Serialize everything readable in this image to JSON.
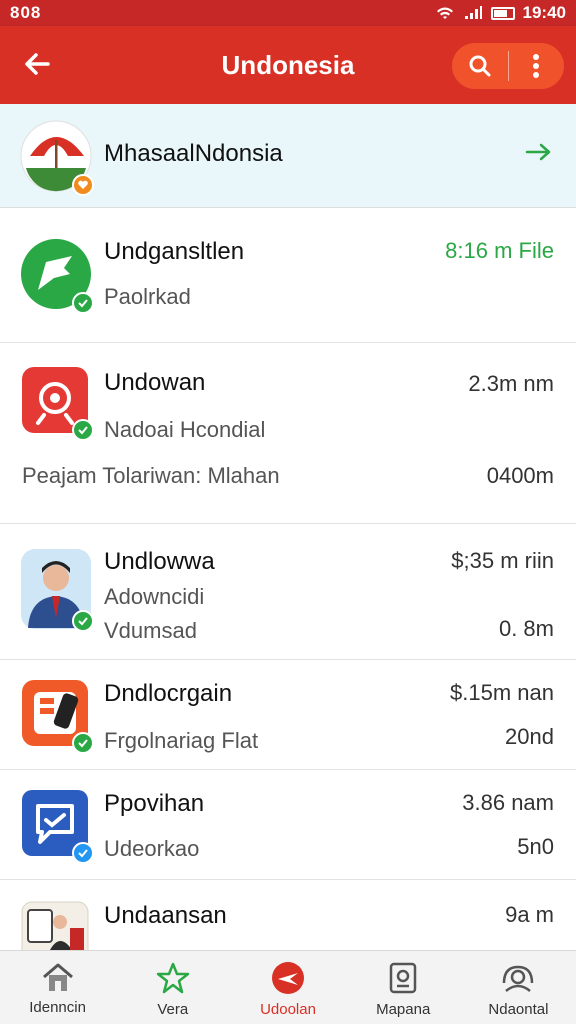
{
  "status_bar": {
    "left": "808",
    "time": "19:40"
  },
  "app_bar": {
    "title": "Undonesia"
  },
  "featured": {
    "title": "MhasaalNdonsia"
  },
  "items": [
    {
      "name": "Undgansltlen",
      "right_top": "8:16 m File",
      "subtitle": "Paolrkad"
    },
    {
      "name": "Undowan",
      "right_top": "2.3m nm",
      "subtitle": "Nadoai Hcondial",
      "extra_left": "Peajam Tolariwan: Mlahan",
      "extra_right": "0400m"
    },
    {
      "name": "Undlowwa",
      "right_top": "$;35 m riin",
      "subtitle": "Adowncidi",
      "sub2": "Vdumsad",
      "right_bottom": "0. 8m"
    },
    {
      "name": "Dndlocrgain",
      "right_top": "$.15m nan",
      "subtitle": "Frgolnariag Flat",
      "right_bottom": "20nd"
    },
    {
      "name": "Ppovihan",
      "right_top": "3.86 nam",
      "subtitle": "Udeorkao",
      "right_bottom": "5n0"
    },
    {
      "name": "Undaansan",
      "right_top": "9a m"
    }
  ],
  "nav": [
    {
      "label": "Idenncin"
    },
    {
      "label": "Vera"
    },
    {
      "label": "Udoolan"
    },
    {
      "label": "Mapana"
    },
    {
      "label": "Ndaontal"
    }
  ],
  "colors": {
    "accent": "#d93025",
    "green": "#2aa845",
    "blue": "#2b5cbf"
  }
}
